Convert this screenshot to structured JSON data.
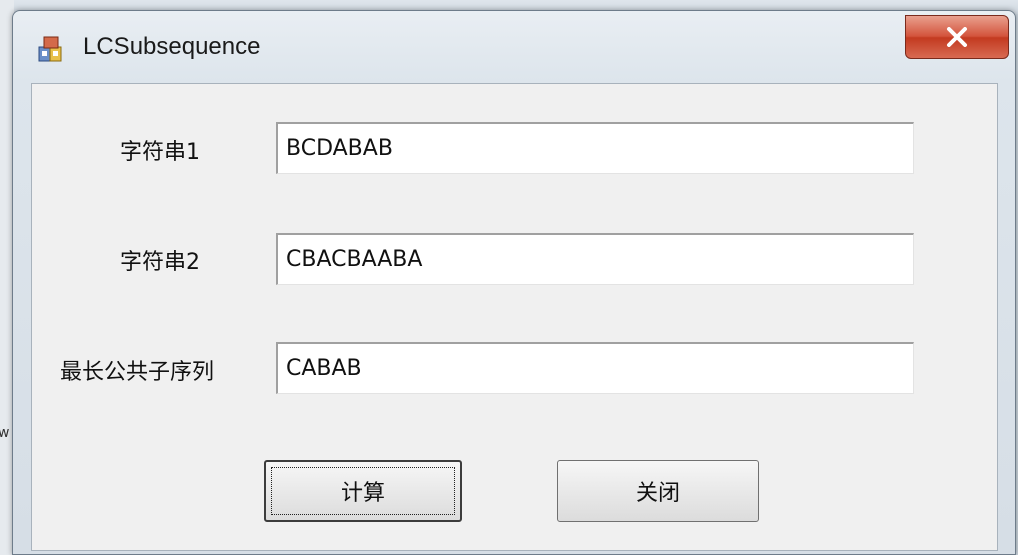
{
  "window": {
    "title": "LCSubsequence",
    "app_icon": "application-icon",
    "close_icon": "close-icon"
  },
  "form": {
    "fields": [
      {
        "label": "字符串1",
        "value": "BCDABAB"
      },
      {
        "label": "字符串2",
        "value": "CBACBAABA"
      },
      {
        "label": "最长公共子序列",
        "value": "CABAB"
      }
    ],
    "compute_button": "计算",
    "close_button": "关闭"
  },
  "background": {
    "stray_text": "w"
  },
  "colors": {
    "close_button": "#c33a20",
    "client_bg": "#f0f0f0"
  }
}
